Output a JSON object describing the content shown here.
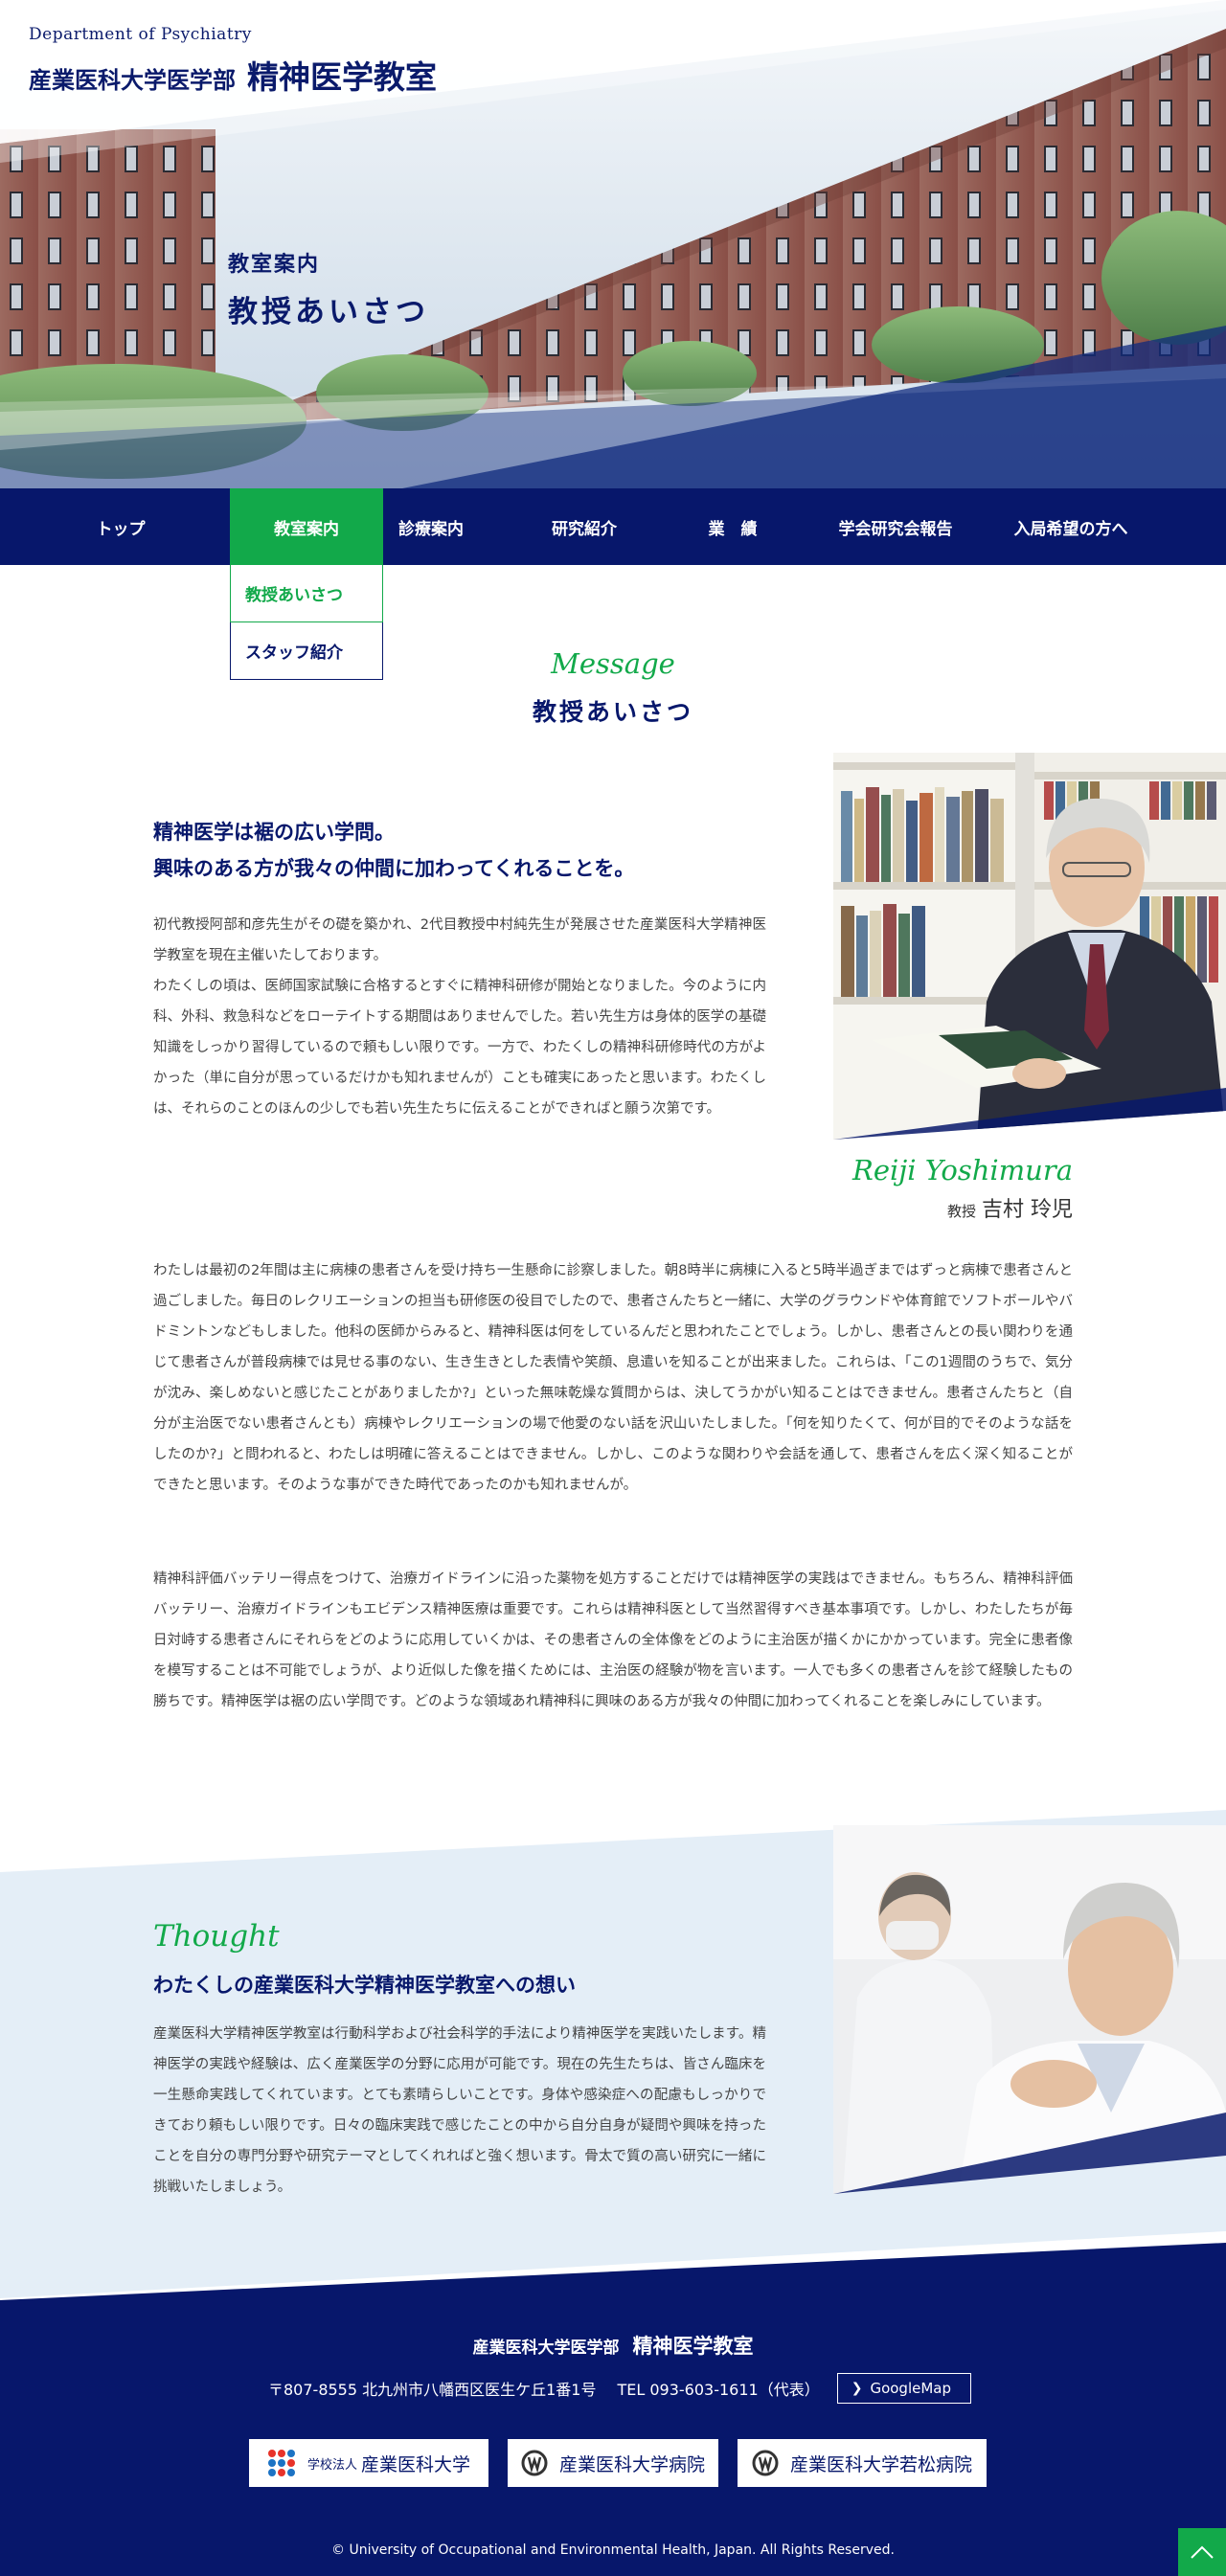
{
  "header": {
    "department_en": "Department of Psychiatry",
    "school": "産業医科大学医学部",
    "department_jp": "精神医学教室"
  },
  "hero": {
    "category": "教室案内",
    "title": "教授あいさつ"
  },
  "nav": {
    "items": [
      {
        "label": "トップ"
      },
      {
        "label": "教室案内"
      },
      {
        "label": "診療案内"
      },
      {
        "label": "研究紹介"
      },
      {
        "label": "業　績"
      },
      {
        "label": "学会研究会報告"
      },
      {
        "label": "入局希望の方へ"
      }
    ],
    "active_index": 1,
    "submenu": [
      {
        "label": "教授あいさつ"
      },
      {
        "label": "スタッフ紹介"
      }
    ]
  },
  "message": {
    "heading_en": "Message",
    "heading_jp": "教授あいさつ",
    "lead_line1": "精神医学は裾の広い学問。",
    "lead_line2": "興味のある方が我々の仲間に加わってくれることを。",
    "para1": "初代教授阿部和彦先生がその礎を築かれ、2代目教授中村純先生が発展させた産業医科大学精神医学教室を現在主催いたしております。\nわたくしの頃は、医師国家試験に合格するとすぐに精神科研修が開始となりました。今のように内科、外科、救急科などをローテイトする期間はありませんでした。若い先生方は身体的医学の基礎知識をしっかり習得しているので頼もしい限りです。一方で、わたくしの精神科研修時代の方がよかった（単に自分が思っているだけかも知れませんが）ことも確実にあったと思います。わたくしは、それらのことのほんの少しでも若い先生たちに伝えることができればと願う次第です。",
    "para2": "わたしは最初の2年間は主に病棟の患者さんを受け持ち一生懸命に診察しました。朝8時半に病棟に入ると5時半過ぎまではずっと病棟で患者さんと過ごしました。毎日のレクリエーションの担当も研修医の役目でしたので、患者さんたちと一緒に、大学のグラウンドや体育館でソフトボールやバドミントンなどもしました。他科の医師からみると、精神科医は何をしているんだと思われたことでしょう。しかし、患者さんとの長い関わりを通じて患者さんが普段病棟では見せる事のない、生き生きとした表情や笑顔、息遣いを知ることが出来ました。これらは、「この1週間のうちで、気分が沈み、楽しめないと感じたことがありましたか?」といった無味乾燥な質問からは、決してうかがい知ることはできません。患者さんたちと（自分が主治医でない患者さんとも）病棟やレクリエーションの場で他愛のない話を沢山いたしました。「何を知りたくて、何が目的でそのような話をしたのか?」と問われると、わたしは明確に答えることはできません。しかし、このような関わりや会話を通して、患者さんを広く深く知ることができたと思います。そのような事ができた時代であったのかも知れませんが。",
    "para3": "精神科評価バッテリー得点をつけて、治療ガイドラインに沿った薬物を処方することだけでは精神医学の実践はできません。もちろん、精神科評価バッテリー、治療ガイドラインもエビデンス精神医療は重要です。これらは精神科医として当然習得すべき基本事項です。しかし、わたしたちが毎日対峙する患者さんにそれらをどのように応用していくかは、その患者さんの全体像をどのように主治医が描くかにかかっています。完全に患者像を模写することは不可能でしょうが、より近似した像を描くためには、主治医の経験が物を言います。一人でも多くの患者さんを診て経験したもの勝ちです。精神医学は裾の広い学問です。どのような領域あれ精神科に興味のある方が我々の仲間に加わってくれることを楽しみにしています。",
    "signature_en": "Reiji Yoshimura",
    "signature_role": "教授",
    "signature_name": "吉村 玲児"
  },
  "thought": {
    "heading_en": "Thought",
    "heading_jp": "わたくしの産業医科大学精神医学教室への想い",
    "para": "産業医科大学精神医学教室は行動科学および社会科学的手法により精神医学を実践いたします。精神医学の実践や経験は、広く産業医学の分野に応用が可能です。現在の先生たちは、皆さん臨床を一生懸命実践してくれています。とても素晴らしいことです。身体や感染症への配慮もしっかりできており頼もしい限りです。日々の臨床実践で感じたことの中から自分自身が疑問や興味を持ったことを自分の専門分野や研究テーマとしてくれればと強く想います。骨太で質の高い研究に一緒に挑戦いたしましょう。"
  },
  "footer": {
    "school": "産業医科大学医学部",
    "department": "精神医学教室",
    "address": "〒807-8555 北九州市八幡西区医生ケ丘1番1号",
    "tel": "TEL 093-603-1611（代表）",
    "gmap_label": "GoogleMap",
    "logos": [
      {
        "prefix": "学校法人",
        "label": "産業医科大学"
      },
      {
        "label": "産業医科大学病院"
      },
      {
        "label": "産業医科大学若松病院"
      }
    ],
    "copyright": "© University of Occupational and Environmental Health, Japan. All Rights Reserved."
  },
  "colors": {
    "navy": "#07176b",
    "green": "#12a94a",
    "light_blue_bg": "#e4eef7"
  },
  "icons": [
    "chevron-right-icon",
    "chevron-up-icon",
    "uoeh-logo-icon",
    "hospital-logo-icon"
  ]
}
